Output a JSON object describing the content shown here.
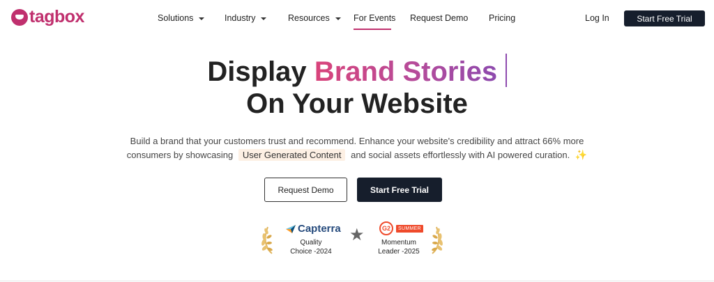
{
  "brand": {
    "logo_text": "tagbox",
    "color": "#c0306e"
  },
  "nav": {
    "items": [
      {
        "label": "Solutions",
        "dropdown": true
      },
      {
        "label": "Industry",
        "dropdown": true
      },
      {
        "label": "Resources",
        "dropdown": true
      },
      {
        "label": "For Events",
        "dropdown": false,
        "active": true
      },
      {
        "label": "Request Demo",
        "dropdown": false
      },
      {
        "label": "Pricing",
        "dropdown": false
      }
    ],
    "login_label": "Log In",
    "cta_label": "Start Free Trial"
  },
  "hero": {
    "line1_prefix": "Display",
    "line1_highlight": "Brand Stories",
    "line2": "On Your Website",
    "sub_line1": "Build a brand that your customers trust and recommend. Enhance your website's credibility and attract 66% more",
    "sub_line2_prefix": "consumers by showcasing",
    "sub_line2_highlight": "User Generated Content",
    "sub_line2_suffix": "and social assets effortlessly with AI powered curation.",
    "sparkle_icon": "sparkle-icon",
    "request_demo_label": "Request Demo",
    "start_trial_label": "Start Free Trial"
  },
  "badges": {
    "capterra": {
      "name": "Capterra",
      "line1": "Quality",
      "line2": "Choice -2024"
    },
    "g2": {
      "logo": "G2",
      "tag": "SUMMER",
      "line1": "Momentum",
      "line2": "Leader -2025"
    }
  },
  "colors": {
    "dark_button": "#161e2c",
    "gradient_start": "#d9437a",
    "gradient_end": "#8d4aae",
    "highlight_bg": "#fdf0e4"
  }
}
